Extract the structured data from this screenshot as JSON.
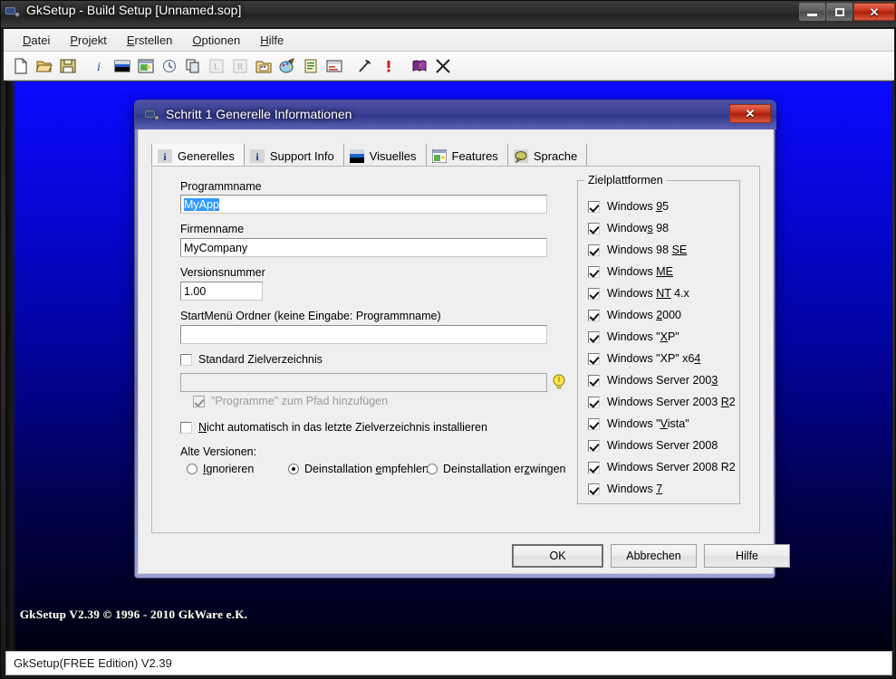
{
  "app": {
    "title": "GkSetup - Build Setup [Unnamed.sop]",
    "icon": "gksetup-app-icon",
    "window_controls": {
      "minimize": "–",
      "maximize": "□",
      "close": "✕"
    }
  },
  "menubar": {
    "items": [
      {
        "label": "Datei",
        "mnemonic": "D"
      },
      {
        "label": "Projekt",
        "mnemonic": "P"
      },
      {
        "label": "Erstellen",
        "mnemonic": "E"
      },
      {
        "label": "Optionen",
        "mnemonic": "O"
      },
      {
        "label": "Hilfe",
        "mnemonic": "H"
      }
    ]
  },
  "toolbar": {
    "buttons": [
      {
        "name": "new-document-icon"
      },
      {
        "name": "open-folder-icon"
      },
      {
        "name": "save-disk-icon"
      },
      {
        "name": "separator"
      },
      {
        "name": "info-icon"
      },
      {
        "name": "screen-banner-icon"
      },
      {
        "name": "image-window-icon"
      },
      {
        "name": "clock-icon"
      },
      {
        "name": "copy-icon"
      },
      {
        "name": "license-l-icon"
      },
      {
        "name": "register-r-icon"
      },
      {
        "name": "folder-files-icon"
      },
      {
        "name": "paint-palette-icon"
      },
      {
        "name": "clipboard-notes-icon"
      },
      {
        "name": "dialog-list-icon"
      },
      {
        "name": "separator"
      },
      {
        "name": "hammer-build-icon"
      },
      {
        "name": "exclamation-icon"
      },
      {
        "name": "separator"
      },
      {
        "name": "help-book-icon"
      },
      {
        "name": "close-x-icon"
      }
    ]
  },
  "desktop": {
    "copyright": "GkSetup V2.39 © 1996 - 2010 GkWare e.K.",
    "bg_top_color": "#0a0aff",
    "bg_bottom_color": "#000010"
  },
  "statusbar": {
    "text": "GkSetup(FREE Edition) V2.39"
  },
  "dialog": {
    "title": "Schritt 1 Generelle Informationen",
    "icon": "gksetup-app-icon",
    "close_label": "✕",
    "tabs": [
      {
        "label": "Generelles",
        "icon": "info-blue-icon",
        "active": true
      },
      {
        "label": "Support Info",
        "icon": "info-blue-icon",
        "active": false
      },
      {
        "label": "Visuelles",
        "icon": "banner-image-icon",
        "active": false
      },
      {
        "label": "Features",
        "icon": "window-green-icon",
        "active": false
      },
      {
        "label": "Sprache",
        "icon": "speech-bubble-icon",
        "active": false
      }
    ],
    "fields": {
      "program_name": {
        "label": "Programmname",
        "value": "MyApp",
        "selected": true
      },
      "company_name": {
        "label": "Firmenname",
        "value": "MyCompany"
      },
      "version_number": {
        "label": "Versionsnummer",
        "value": "1.00"
      },
      "startmenu_folder": {
        "label": "StartMenü Ordner (keine Eingabe: Programmname)",
        "value": ""
      },
      "target_dir": {
        "value": "",
        "disabled": true
      }
    },
    "checkboxes": {
      "standard_target_dir": {
        "label": "Standard Zielverzeichnis",
        "checked": false,
        "disabled": false
      },
      "add_programs_to_path": {
        "label": "\"Programme\" zum Pfad hinzufügen",
        "checked": true,
        "disabled": true
      },
      "no_auto_last_target": {
        "label": "Nicht automatisch in das letzte Zielverzeichnis installieren",
        "checked": false,
        "mnemonic": "N"
      }
    },
    "bulb_button": {
      "name": "lightbulb-icon",
      "color": "#ffe24a"
    },
    "old_versions": {
      "label": "Alte Versionen:",
      "options": [
        {
          "label": "Ignorieren",
          "mnemonic": "I",
          "selected": false
        },
        {
          "label": "Deinstallation empfehlen",
          "mnemonic": "e",
          "selected": true
        },
        {
          "label": "Deinstallation erzwingen",
          "mnemonic": "z",
          "selected": false
        }
      ]
    },
    "target_platforms": {
      "legend": "Zielplattformen",
      "items": [
        {
          "label": "Windows 95",
          "checked": true
        },
        {
          "label": "Windows 98",
          "checked": true
        },
        {
          "label": "Windows 98 SE",
          "checked": true
        },
        {
          "label": "Windows ME",
          "checked": true
        },
        {
          "label": "Windows NT 4.x",
          "checked": true
        },
        {
          "label": "Windows 2000",
          "checked": true
        },
        {
          "label": "Windows \"XP\"",
          "checked": true
        },
        {
          "label": "Windows \"XP\" x64",
          "checked": true
        },
        {
          "label": "Windows Server 2003",
          "checked": true
        },
        {
          "label": "Windows Server 2003 R2",
          "checked": true
        },
        {
          "label": "Windows \"Vista\"",
          "checked": true
        },
        {
          "label": "Windows Server 2008",
          "checked": true
        },
        {
          "label": "Windows Server 2008 R2",
          "checked": true
        },
        {
          "label": "Windows 7",
          "checked": true
        }
      ]
    },
    "buttons": {
      "ok": "OK",
      "cancel": "Abbrechen",
      "help": "Hilfe"
    }
  }
}
